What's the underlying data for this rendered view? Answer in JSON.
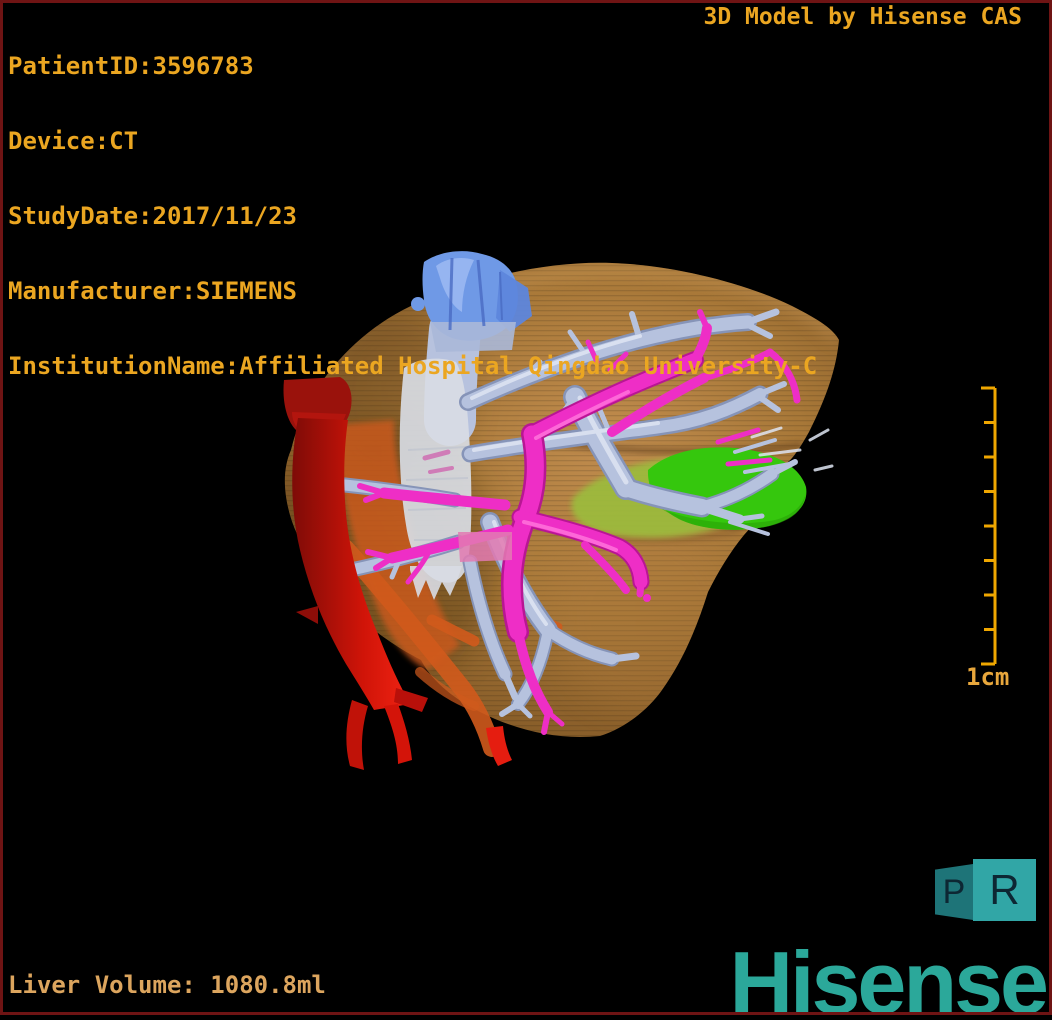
{
  "header": {
    "patient_lines": [
      "PatientID:3596783",
      "Device:CT",
      "StudyDate:2017/11/23",
      "Manufacturer:SIEMENS",
      "InstitutionName:Affiliated Hospital Qingdao University-C"
    ],
    "credit": "3D Model by Hisense CAS"
  },
  "footer": {
    "liver_volume": "Liver Volume: 1080.8ml"
  },
  "scale_bar": {
    "label": "1cm"
  },
  "orientation": {
    "left_face": "P",
    "right_face": "R"
  },
  "brand": {
    "wordmark": "Hisense"
  },
  "model": {
    "structures": [
      "liver",
      "hepatic veins",
      "portal vein",
      "inferior vena cava",
      "aorta",
      "gallbladder"
    ]
  },
  "colors": {
    "background": "#000000",
    "text_orange": "#eba621",
    "text_peach": "#dca55e",
    "scale_gold": "#f0a700",
    "scale_label": "#e8a73c",
    "brand_teal": "#2ba89a",
    "frame_maroon": "#6f1414",
    "marker_face_left": "#1e7478",
    "marker_face_right": "#31a6a6",
    "liver": "#a87838",
    "liver_light": "#c08c4e",
    "liver_dark": "#6e4a1e",
    "hepatic_vein": "#b6c2de",
    "portal_vein": "#ee2ec6",
    "ivc_top": "#6f99e6",
    "ivc_white": "#d8dce4",
    "aorta": "#d01408",
    "aorta_behind": "#d05a1c",
    "gallbladder": "#35c70d",
    "gallbladder_olive": "#9cbc3e"
  }
}
